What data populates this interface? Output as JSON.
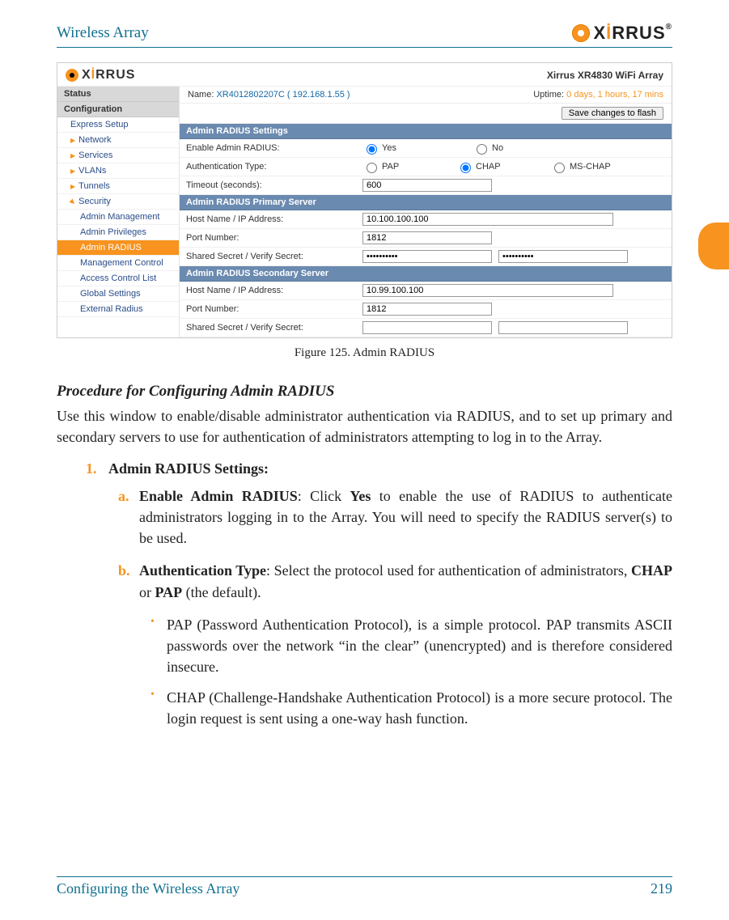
{
  "page": {
    "header_title": "Wireless Array",
    "logo_word_pre": "X",
    "logo_word_i": "İ",
    "logo_word_post": "RRUS",
    "footer_left": "Configuring the Wireless Array",
    "footer_right": "219"
  },
  "screenshot": {
    "product": "Xirrus XR4830 WiFi Array",
    "side": {
      "status": "Status",
      "config": "Configuration",
      "items": [
        {
          "label": "Express Setup",
          "arrow": false
        },
        {
          "label": "Network",
          "arrow": true
        },
        {
          "label": "Services",
          "arrow": true
        },
        {
          "label": "VLANs",
          "arrow": true
        },
        {
          "label": "Tunnels",
          "arrow": true
        },
        {
          "label": "Security",
          "arrow": true,
          "expanded": true
        }
      ],
      "subs": [
        {
          "label": "Admin Management",
          "sel": false
        },
        {
          "label": "Admin Privileges",
          "sel": false
        },
        {
          "label": "Admin RADIUS",
          "sel": true
        },
        {
          "label": "Management Control",
          "sel": false
        },
        {
          "label": "Access Control List",
          "sel": false
        },
        {
          "label": "Global Settings",
          "sel": false
        },
        {
          "label": "External Radius",
          "sel": false
        }
      ]
    },
    "status": {
      "name_label": "Name:",
      "name_value": "XR4012802207C   ( 192.168.1.55 )",
      "uptime_label": "Uptime:",
      "uptime_value": "0 days, 1 hours, 17 mins",
      "save_button": "Save changes to flash"
    },
    "sections": {
      "s1": "Admin RADIUS Settings",
      "s2": "Admin RADIUS Primary Server",
      "s3": "Admin RADIUS Secondary Server"
    },
    "rows": {
      "enable_label": "Enable Admin RADIUS:",
      "enable_yes": "Yes",
      "enable_no": "No",
      "auth_label": "Authentication Type:",
      "auth_pap": "PAP",
      "auth_chap": "CHAP",
      "auth_mschap": "MS-CHAP",
      "timeout_label": "Timeout (seconds):",
      "timeout_value": "600",
      "host_label": "Host Name / IP Address:",
      "host1": "10.100.100.100",
      "host2": "10.99.100.100",
      "port_label": "Port Number:",
      "port1": "1812",
      "port2": "1812",
      "secret_label": "Shared Secret / Verify Secret:",
      "secret1a": "••••••••••",
      "secret1b": "••••••••••",
      "secret2a": "",
      "secret2b": ""
    }
  },
  "caption": "Figure 125. Admin RADIUS",
  "body": {
    "h": "Procedure for Configuring Admin RADIUS",
    "p1": "Use this window to enable/disable administrator authentication via RADIUS, and to set up primary and secondary servers to use for authentication of administrators attempting to log in to the Array.",
    "l1_num": "1.",
    "l1_txt": "Admin RADIUS Settings:",
    "a_let": "a.",
    "a_txt_b": "Enable Admin RADIUS",
    "a_txt_mid": ": Click ",
    "a_txt_yes": "Yes",
    "a_txt_rest": " to enable the use of RADIUS to authenticate administrators logging in to the Array. You will need to specify the RADIUS server(s) to be used.",
    "b_let": "b.",
    "b_txt_b": "Authentication Type",
    "b_txt_mid": ": Select the protocol used for authentication of administrators, ",
    "b_txt_chap": "CHAP",
    "b_txt_or": " or ",
    "b_txt_pap": "PAP",
    "b_txt_end": " (the default).",
    "bul1": "PAP (Password Authentication Protocol), is a simple protocol. PAP transmits ASCII passwords over the network “in the clear” (unencrypted) and is therefore considered insecure.",
    "bul2": "CHAP (Challenge-Handshake Authentication Protocol) is a more secure protocol. The login request is sent using a one-way hash function."
  }
}
